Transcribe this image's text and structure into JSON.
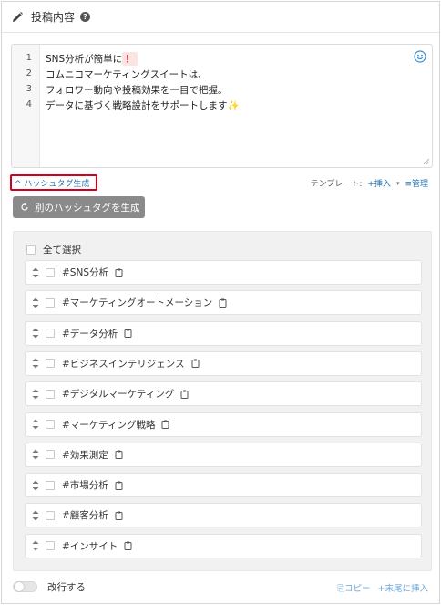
{
  "header": {
    "title": "投稿内容",
    "help": "?"
  },
  "editor": {
    "lines": [
      {
        "num": "1",
        "text": "SNS分析が簡単に",
        "badge": "！"
      },
      {
        "num": "2",
        "text": "コムニコマーケティングスイートは、"
      },
      {
        "num": "3",
        "text": "フォロワー動向や投稿効果を一目で把握。"
      },
      {
        "num": "4",
        "text": "データに基づく戦略設計をサポートします",
        "suffix": "✨"
      }
    ]
  },
  "hashtag_toggle": "^ ハッシュタグ生成",
  "template": {
    "label": "テンプレート:",
    "insert": "+挿入",
    "caret": "▾",
    "manage": "≡管理"
  },
  "generate_button": "別のハッシュタグを生成",
  "select_all": "全て選択",
  "hashtags": [
    "#SNS分析",
    "#マーケティングオートメーション",
    "#データ分析",
    "#ビジネスインテリジェンス",
    "#デジタルマーケティング",
    "#マーケティング戦略",
    "#効果測定",
    "#市場分析",
    "#顧客分析",
    "#インサイト"
  ],
  "footer": {
    "toggle_label": "改行する",
    "copy": "⎘コピー",
    "append": "+末尾に挿入"
  },
  "colors": {
    "accent": "#2271b1",
    "highlight_border": "#d0021b",
    "button_bg": "#8a8a8a"
  }
}
